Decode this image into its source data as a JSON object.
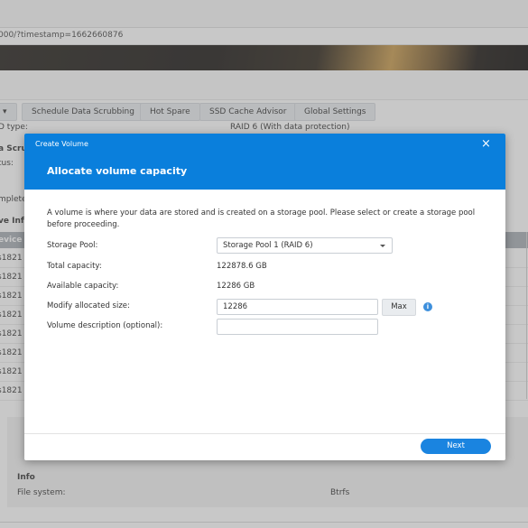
{
  "browser": {
    "url": "000/?timestamp=1662660876"
  },
  "background": {
    "toolbar": {
      "dropdown_label": "▾",
      "schedule_label": "Schedule Data Scrubbing",
      "hot_spare_label": "Hot Spare",
      "ssd_advisor_label": "SSD Cache Advisor",
      "global_settings_label": "Global Settings"
    },
    "raid_type_label": "D type:",
    "raid_type_value": "RAID 6 (With data protection)",
    "scrub_heading": "a Scru",
    "status_label": "tus:",
    "completed_label": "mpleted",
    "drive_info_heading": "ve Inf",
    "table_header": "evice",
    "rows": [
      "s1821",
      "s1821",
      "s1821",
      "s1821",
      "s1821",
      "s1821",
      "s1821",
      "s1821"
    ],
    "info_heading": "Info",
    "file_system_label": "File system:",
    "file_system_value": "Btrfs"
  },
  "modal": {
    "window_title": "Create Volume",
    "step_title": "Allocate volume capacity",
    "description": "A volume is where your data are stored and is created on a storage pool. Please select or create a storage pool before proceeding.",
    "storage_pool_label": "Storage Pool:",
    "storage_pool_value": "Storage Pool 1 (RAID 6)",
    "total_capacity_label": "Total capacity:",
    "total_capacity_value": "122878.6 GB",
    "available_capacity_label": "Available capacity:",
    "available_capacity_value": "12286 GB",
    "allocated_size_label": "Modify allocated size:",
    "allocated_size_value": "12286",
    "max_label": "Max",
    "description_label": "Volume description (optional):",
    "description_value": "",
    "next_label": "Next",
    "close_glyph": "×",
    "info_glyph": "i"
  },
  "colors": {
    "accent": "#0a7fdc",
    "next_button": "#1a84e0"
  }
}
